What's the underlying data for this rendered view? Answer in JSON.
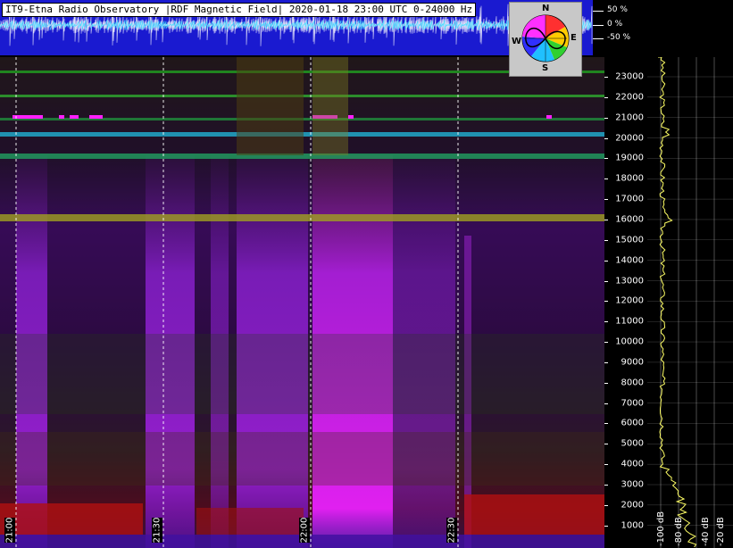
{
  "title": "IT9-Etna Radio Observatory |RDF Magnetic Field| 2020-01-18 23:00 UTC 0-24000 Hz",
  "amplitude_scale": [
    "50 %",
    "0 %",
    "-50 %"
  ],
  "compass": {
    "north": "N",
    "south": "S",
    "east": "E",
    "west": "W"
  },
  "freq_labels": [
    "23000",
    "22000",
    "21000",
    "20000",
    "19000",
    "18000",
    "17000",
    "16000",
    "15000",
    "14000",
    "13000",
    "12000",
    "11000",
    "10000",
    "9000",
    "8000",
    "7000",
    "6000",
    "5000",
    "4000",
    "3000",
    "2000",
    "1000"
  ],
  "time_labels": [
    "21:00",
    "21:30",
    "22:00",
    "22:30"
  ],
  "db_labels": [
    "-100 dB",
    "-80 dB",
    "-40 dB",
    "-20 dB"
  ],
  "colors": {
    "amp_bg": "#1a1ad0",
    "trace": "#ffffff",
    "spectrum_line": "#ffff66",
    "grid": "#ffffff"
  }
}
